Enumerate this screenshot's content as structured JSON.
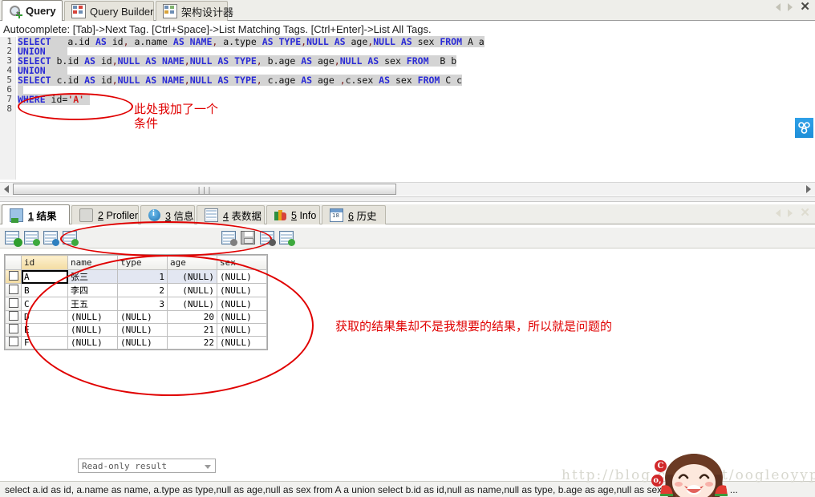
{
  "window": {
    "top_tabs": [
      {
        "label": "Query",
        "icon": "query-icon",
        "active": true
      },
      {
        "label": "Query Builder",
        "icon": "query-builder-icon",
        "active": false
      },
      {
        "label": "架构设计器",
        "icon": "schema-designer-icon",
        "active": false
      }
    ],
    "nav": {
      "prev": "prev-arrow-icon",
      "next": "next-arrow-icon",
      "close": "✕"
    }
  },
  "hint": {
    "text": "Autocomplete: [Tab]->Next Tag. [Ctrl+Space]->List Matching Tags. [Ctrl+Enter]->List All Tags."
  },
  "editor": {
    "line_numbers": [
      "1",
      "2",
      "3",
      "4",
      "5",
      "6",
      "7",
      "8"
    ],
    "lines": [
      "SELECT   a.id AS id, a.name AS NAME, a.type AS TYPE,NULL AS age,NULL AS sex FROM A a",
      "UNION",
      "SELECT b.id AS id,NULL AS NAME,NULL AS TYPE, b.age AS age,NULL AS sex FROM  B b",
      "UNION",
      "SELECT c.id AS id,NULL AS NAME,NULL AS TYPE, c.age AS age ,c.sex AS sex FROM C c",
      "",
      "WHERE id='A'",
      ""
    ],
    "annotation_1": "此处我加了一个",
    "annotation_2": "条件",
    "side_button": "link-nodes-icon"
  },
  "scrollbar": {
    "grip": "|||",
    "left": "scroll-left-arrow",
    "right": "scroll-right-arrow"
  },
  "result_tabs": [
    {
      "num": "1",
      "label": "结果",
      "icon": "result-grid-icon",
      "active": true
    },
    {
      "num": "2",
      "label": "Profiler",
      "icon": "profiler-icon",
      "active": false
    },
    {
      "num": "3",
      "label": "信息",
      "icon": "info-circle-icon",
      "active": false
    },
    {
      "num": "4",
      "label": "表数据",
      "icon": "table-data-icon",
      "active": false
    },
    {
      "num": "5",
      "label": "Info",
      "icon": "chart-icon",
      "active": false
    },
    {
      "num": "6",
      "label": "历史",
      "icon": "calendar-icon",
      "active": false
    }
  ],
  "result_toolbar": {
    "mode_value": "Read-only result",
    "buttons": [
      "grid-add-icon",
      "grid-refresh-icon",
      "grid-export-icon",
      "grid-apply-icon",
      "grid-commit-icon",
      "save-icon",
      "grid-down-icon",
      "grid-sync-icon"
    ]
  },
  "grid": {
    "columns": [
      "id",
      "name",
      "type",
      "age",
      "sex"
    ],
    "rows": [
      {
        "id": "A",
        "name": "张三",
        "type": "1",
        "age": "(NULL)",
        "sex": "(NULL)"
      },
      {
        "id": "B",
        "name": "李四",
        "type": "2",
        "age": "(NULL)",
        "sex": "(NULL)"
      },
      {
        "id": "C",
        "name": "王五",
        "type": "3",
        "age": "(NULL)",
        "sex": "(NULL)"
      },
      {
        "id": "D",
        "name": "(NULL)",
        "type": "(NULL)",
        "age": "20",
        "sex": "(NULL)"
      },
      {
        "id": "E",
        "name": "(NULL)",
        "type": "(NULL)",
        "age": "21",
        "sex": "(NULL)"
      },
      {
        "id": "F",
        "name": "(NULL)",
        "type": "(NULL)",
        "age": "22",
        "sex": "(NULL)"
      }
    ],
    "annotation": "获取的结果集却不是我想要的结果，所以就是问题的"
  },
  "statusbar": {
    "text": "select  a.id as id, a.name as name, a.type as type,null as age,null as sex from A a union select b.id as id,null as name,null as type, b.age as age,null as sex from  B b union ..."
  },
  "watermark": {
    "text": "http://blog.csdn.net/oogleoyyp"
  },
  "mascot": {
    "badge_c": "C",
    "badge_o": "o,"
  },
  "colors": {
    "annotation_red": "#e00000",
    "keyword_blue": "#2b2bd6",
    "string_red": "#d21d1d",
    "accent_blue": "#2fa0e8"
  }
}
